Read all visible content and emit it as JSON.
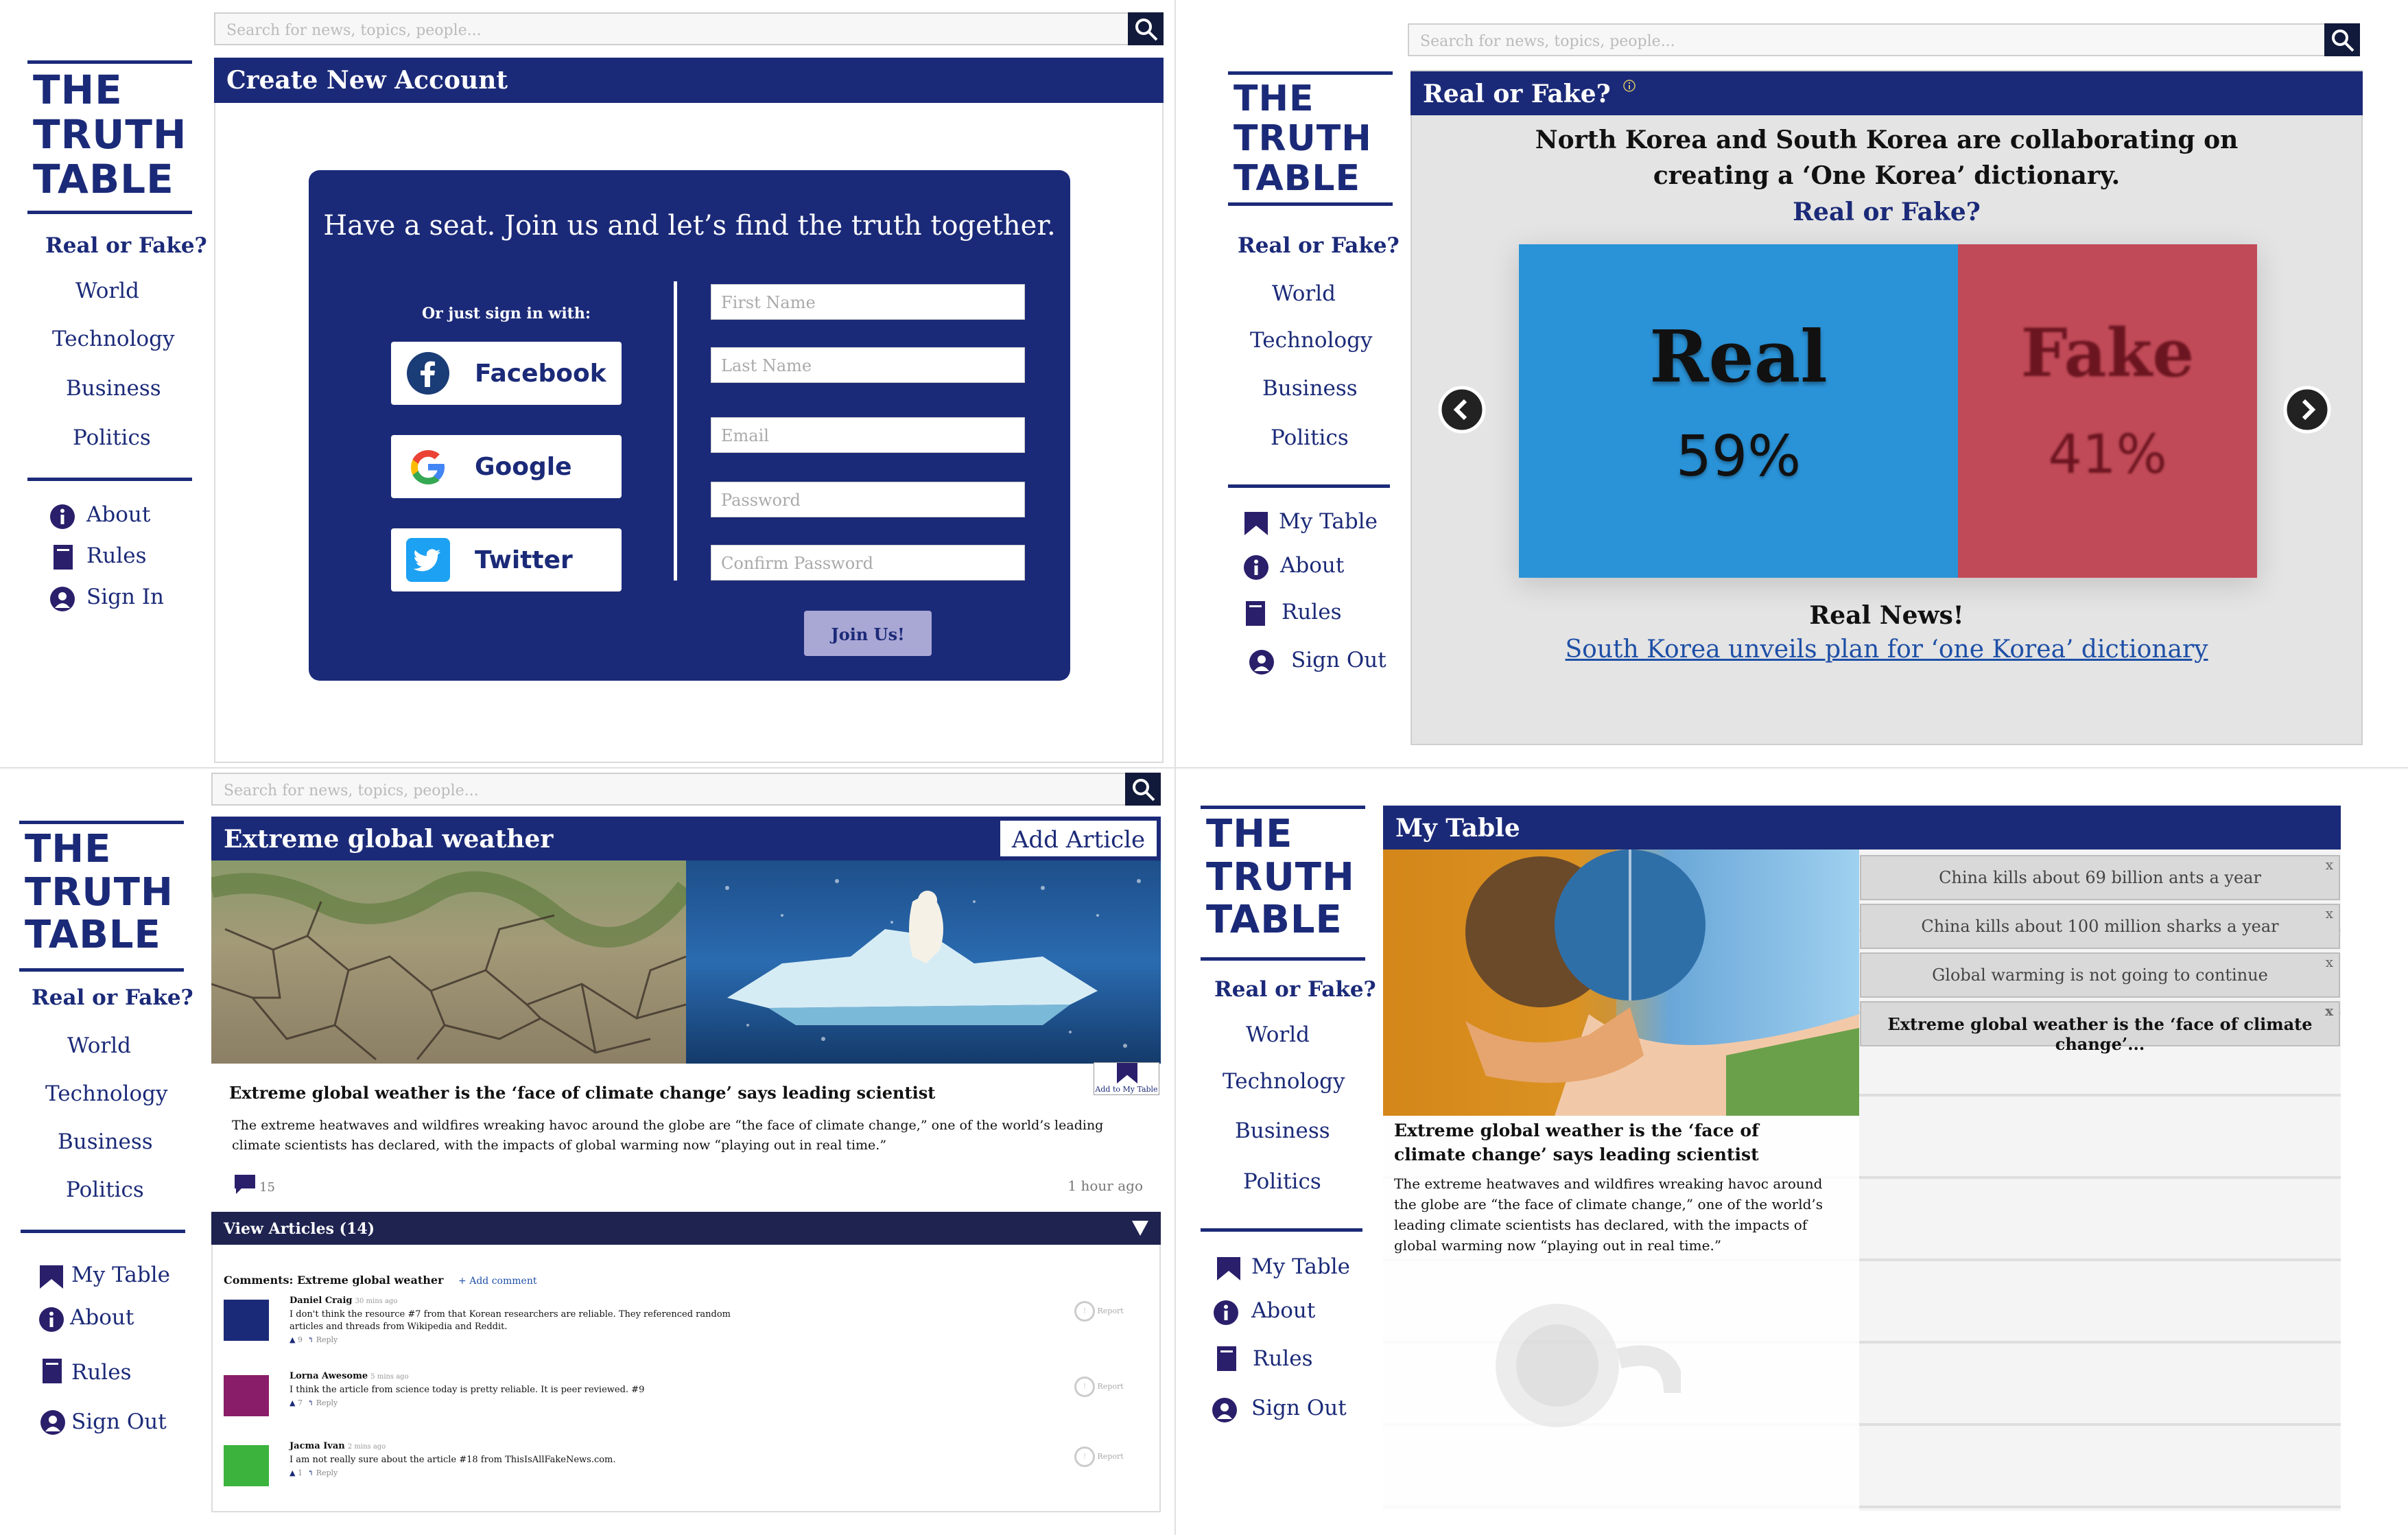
{
  "brand": {
    "logo_line1": "THE",
    "logo_line2": "TRUTH",
    "logo_line3": "TABLE"
  },
  "search": {
    "placeholder": "Search for news, topics, people..."
  },
  "nav": {
    "real_or_fake": "Real or Fake?",
    "world": "World",
    "technology": "Technology",
    "business": "Business",
    "politics": "Politics",
    "my_table": "My Table",
    "about": "About",
    "rules": "Rules",
    "sign_in": "Sign In",
    "sign_out": "Sign Out"
  },
  "create_account": {
    "title": "Create New Account",
    "tagline": "Have a seat. Join us and let’s find the truth together.",
    "or_sign_in": "Or just sign in with:",
    "facebook": "Facebook",
    "google": "Google",
    "twitter": "Twitter",
    "first_name": "First Name",
    "last_name": "Last Name",
    "email": "Email",
    "password": "Password",
    "confirm_password": "Confirm Password",
    "join": "Join Us!"
  },
  "real_or_fake": {
    "title": "Real or Fake?",
    "headline": "North Korea and South Korea are collaborating on creating a ‘One Korea’ dictionary.",
    "question": "Real or Fake?",
    "real_label": "Real",
    "real_pct": "59%",
    "fake_label": "Fake",
    "fake_pct": "41%",
    "real_share": 0.59,
    "verdict": "Real News!",
    "link": "South Korea unveils plan for ‘one Korea’ dictionary"
  },
  "topic": {
    "title": "Extreme global weather",
    "add_article": "Add Article",
    "add_to_table": "Add to My Table",
    "article_title": "Extreme global weather is the ‘face of climate change’ says leading scientist",
    "article_body": "The extreme heatwaves and wildfires wreaking havoc around the globe are “the face of climate change,” one of the world’s leading climate scientists has declared, with the impacts of global warming now “playing out in real time.”",
    "comment_count": "15",
    "time": "1 hour ago",
    "view_articles": "View Articles (14)",
    "comments_header": "Comments: Extreme global weather",
    "add_comment": "+ Add comment",
    "comments": [
      {
        "name": "Daniel Craig",
        "ago": "30 mins ago",
        "text1": "I don't think the resource #7 from that Korean researchers are reliable. They referenced random",
        "text2": "articles and threads from Wikipedia and Reddit.",
        "votes": "9",
        "reply": "Reply",
        "report": "Report",
        "color": "#1b2a78"
      },
      {
        "name": "Lorna Awesome",
        "ago": "5 mins ago",
        "text1": "I think the article from science today is pretty reliable. It is peer reviewed. #9",
        "text2": "",
        "votes": "7",
        "reply": "Reply",
        "report": "Report",
        "color": "#8a1d6a"
      },
      {
        "name": "Jacma Ivan",
        "ago": "2 mins ago",
        "text1": "I am not really sure about the article #18 from ThisIsAllFakeNews.com.",
        "text2": "",
        "votes": "1",
        "reply": "Reply",
        "report": "Report",
        "color": "#3cb33c"
      }
    ]
  },
  "my_table": {
    "title": "My Table",
    "article_title": "Extreme global weather is the ‘face of climate change’ says leading scientist",
    "article_body": "The extreme heatwaves and wildfires wreaking havoc around the globe are “the face of climate change,” one of the world’s leading climate scientists has declared, with the impacts of global warming now “playing out in real time.”",
    "items": [
      {
        "label": "China kills about 69 billion ants a year"
      },
      {
        "label": "China kills about 100 million sharks a year"
      },
      {
        "label": "Global warming is not going to continue"
      },
      {
        "label": "Extreme global weather is the ‘face of climate change’..."
      }
    ],
    "close": "x"
  },
  "colors": {
    "navy": "#1b2a78",
    "real_blue": "#2a93d8",
    "fake_red": "#c14a58",
    "join_btn": "#a9a7d4"
  }
}
